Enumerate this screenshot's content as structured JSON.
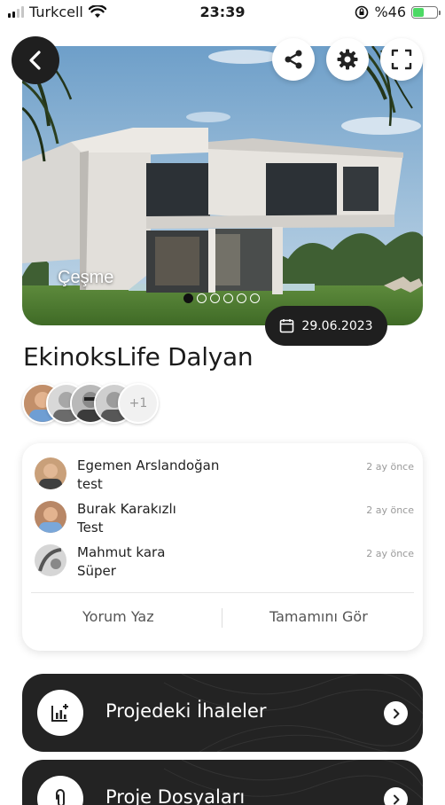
{
  "status_bar": {
    "carrier": "Turkcell",
    "time": "23:39",
    "battery": "%46",
    "battery_level": 0.46
  },
  "hero": {
    "caption": "Çeşme",
    "slide_count": 6,
    "active_slide": 1
  },
  "project": {
    "date": "29.06.2023",
    "title": "EkinoksLife Dalyan",
    "extra_members": "+1"
  },
  "comments": {
    "items": [
      {
        "name": "Egemen Arslandoğan",
        "text": "test",
        "time": "2 ay önce"
      },
      {
        "name": "Burak Karakızlı",
        "text": "Test",
        "time": "2 ay önce"
      },
      {
        "name": "Mahmut kara",
        "text": "Süper",
        "time": "2 ay önce"
      }
    ],
    "write_label": "Yorum Yaz",
    "see_all_label": "Tamamını Gör"
  },
  "menu": {
    "tenders_label": "Projedeki İhaleler",
    "files_label": "Proje Dosyaları"
  },
  "colors": {
    "dark": "#232323",
    "accent_green": "#4cd964"
  }
}
